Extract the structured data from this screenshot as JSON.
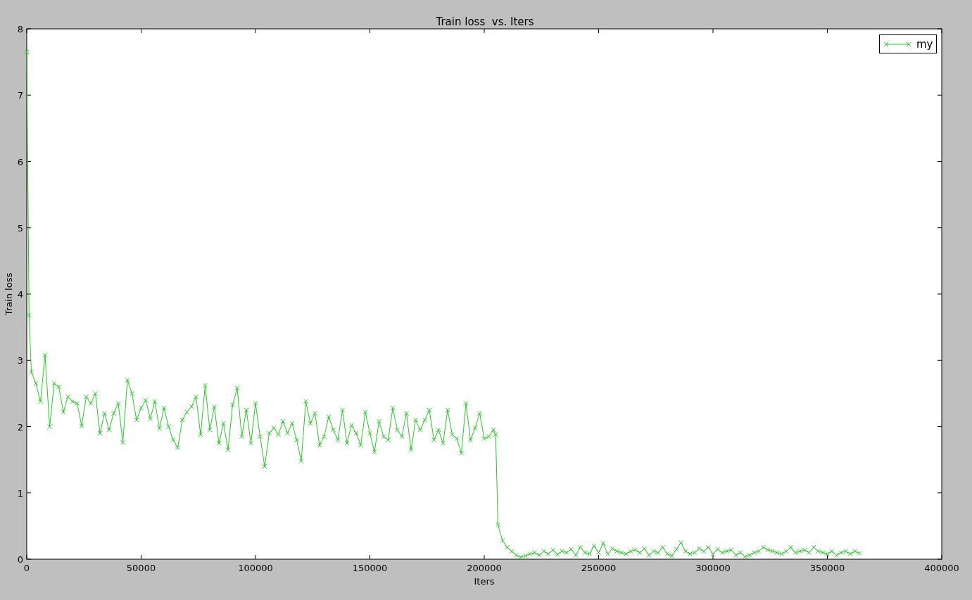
{
  "figure": {
    "chart_data": {
      "type": "line",
      "title": "Train loss  vs. Iters",
      "xlabel": "Iters",
      "ylabel": "Train loss",
      "xlim": [
        0,
        400000
      ],
      "ylim": [
        0,
        8
      ],
      "xticks": [
        0,
        50000,
        100000,
        150000,
        200000,
        250000,
        300000,
        350000,
        400000
      ],
      "yticks": [
        0,
        1,
        2,
        3,
        4,
        5,
        6,
        7,
        8
      ],
      "x": [
        0,
        1000,
        2000,
        4000,
        6000,
        8000,
        10000,
        12000,
        14000,
        16000,
        18000,
        20000,
        22000,
        24000,
        26000,
        28000,
        30000,
        32000,
        34000,
        36000,
        38000,
        40000,
        42000,
        44000,
        46000,
        48000,
        50000,
        52000,
        54000,
        56000,
        58000,
        60000,
        62000,
        64000,
        66000,
        68000,
        70000,
        72000,
        74000,
        76000,
        78000,
        80000,
        82000,
        84000,
        86000,
        88000,
        90000,
        92000,
        94000,
        96000,
        98000,
        100000,
        102000,
        104000,
        106000,
        108000,
        110000,
        112000,
        114000,
        116000,
        118000,
        120000,
        122000,
        124000,
        126000,
        128000,
        130000,
        132000,
        134000,
        136000,
        138000,
        140000,
        142000,
        144000,
        146000,
        148000,
        150000,
        152000,
        154000,
        156000,
        158000,
        160000,
        162000,
        164000,
        166000,
        168000,
        170000,
        172000,
        174000,
        176000,
        178000,
        180000,
        182000,
        184000,
        186000,
        188000,
        190000,
        192000,
        194000,
        196000,
        198000,
        200000,
        202000,
        204000,
        205000,
        206000,
        208000,
        210000,
        212000,
        214000,
        216000,
        218000,
        220000,
        222000,
        224000,
        226000,
        228000,
        230000,
        232000,
        234000,
        236000,
        238000,
        240000,
        242000,
        244000,
        246000,
        248000,
        250000,
        252000,
        254000,
        256000,
        258000,
        260000,
        262000,
        264000,
        266000,
        268000,
        270000,
        272000,
        274000,
        276000,
        278000,
        280000,
        282000,
        284000,
        286000,
        288000,
        290000,
        292000,
        294000,
        296000,
        298000,
        300000,
        302000,
        304000,
        306000,
        308000,
        310000,
        312000,
        314000,
        316000,
        318000,
        320000,
        322000,
        324000,
        326000,
        328000,
        330000,
        332000,
        334000,
        336000,
        338000,
        340000,
        342000,
        344000,
        346000,
        348000,
        350000,
        352000,
        354000,
        356000,
        358000,
        360000,
        362000,
        364000
      ],
      "series": [
        {
          "name": "my",
          "color": "#22cc22",
          "marker": "x",
          "values": [
            7.65,
            3.68,
            2.82,
            2.65,
            2.38,
            3.08,
            2.0,
            2.65,
            2.6,
            2.22,
            2.45,
            2.38,
            2.35,
            2.01,
            2.45,
            2.35,
            2.5,
            1.9,
            2.2,
            1.95,
            2.2,
            2.35,
            1.76,
            2.7,
            2.5,
            2.1,
            2.28,
            2.4,
            2.12,
            2.38,
            1.97,
            2.28,
            2.0,
            1.8,
            1.68,
            2.1,
            2.22,
            2.3,
            2.45,
            1.88,
            2.62,
            1.95,
            2.3,
            1.75,
            2.05,
            1.65,
            2.33,
            2.58,
            1.85,
            2.25,
            1.75,
            2.35,
            1.85,
            1.4,
            1.9,
            1.98,
            1.88,
            2.08,
            1.9,
            2.05,
            1.8,
            1.48,
            2.38,
            2.05,
            2.2,
            1.72,
            1.85,
            2.15,
            1.95,
            1.8,
            2.25,
            1.75,
            2.02,
            1.9,
            1.72,
            2.22,
            1.9,
            1.62,
            2.08,
            1.85,
            1.8,
            2.28,
            1.95,
            1.85,
            2.2,
            1.65,
            2.1,
            1.95,
            2.1,
            2.25,
            1.8,
            1.95,
            1.75,
            2.25,
            1.88,
            1.82,
            1.6,
            2.35,
            1.8,
            1.98,
            2.2,
            1.82,
            1.85,
            1.95,
            1.88,
            0.52,
            0.28,
            0.18,
            0.12,
            0.06,
            0.03,
            0.05,
            0.08,
            0.1,
            0.06,
            0.12,
            0.08,
            0.14,
            0.07,
            0.12,
            0.1,
            0.15,
            0.06,
            0.18,
            0.1,
            0.08,
            0.2,
            0.1,
            0.24,
            0.08,
            0.16,
            0.12,
            0.1,
            0.08,
            0.12,
            0.14,
            0.1,
            0.16,
            0.06,
            0.12,
            0.1,
            0.18,
            0.08,
            0.05,
            0.15,
            0.25,
            0.12,
            0.08,
            0.1,
            0.16,
            0.12,
            0.18,
            0.08,
            0.15,
            0.1,
            0.12,
            0.14,
            0.06,
            0.1,
            0.04,
            0.06,
            0.1,
            0.12,
            0.18,
            0.14,
            0.12,
            0.1,
            0.08,
            0.12,
            0.18,
            0.1,
            0.12,
            0.14,
            0.1,
            0.18,
            0.12,
            0.1,
            0.08,
            0.12,
            0.06,
            0.1,
            0.12,
            0.08,
            0.12,
            0.09
          ]
        }
      ]
    }
  }
}
